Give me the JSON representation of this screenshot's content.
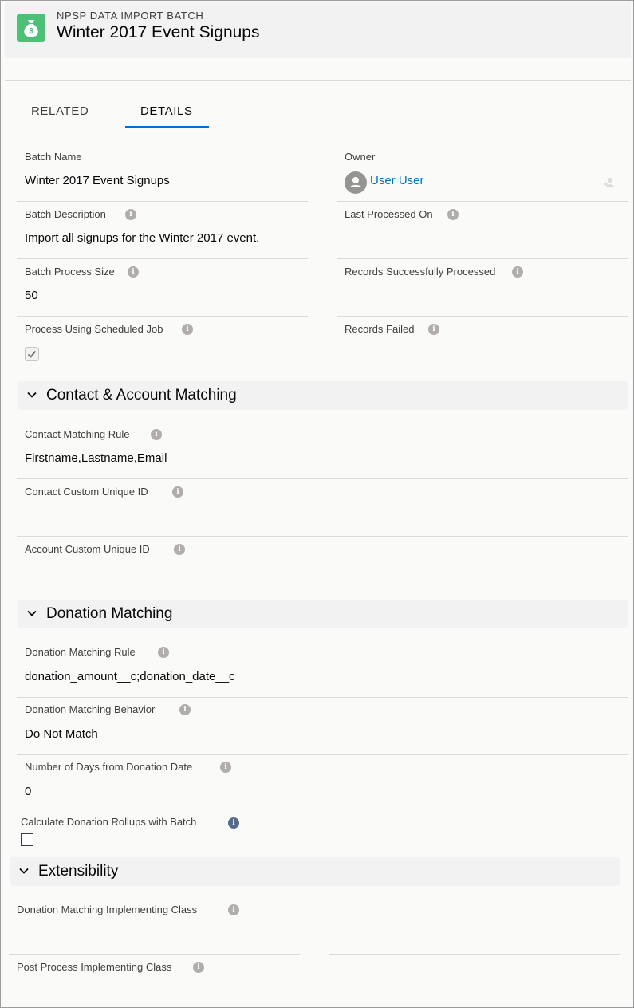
{
  "header": {
    "object_label": "NPSP DATA IMPORT BATCH",
    "title": "Winter 2017 Event Signups",
    "icon": "money-bag-icon",
    "accent_color": "#4bc076"
  },
  "tabs": [
    {
      "label": "RELATED",
      "active": false
    },
    {
      "label": "DETAILS",
      "active": true
    }
  ],
  "details": {
    "batch_name": {
      "label": "Batch Name",
      "value": "Winter 2017 Event Signups"
    },
    "owner": {
      "label": "Owner",
      "value": "User User"
    },
    "batch_description": {
      "label": "Batch Description",
      "value": "Import all signups for the Winter 2017 event."
    },
    "last_processed_on": {
      "label": "Last Processed On",
      "value": ""
    },
    "batch_process_size": {
      "label": "Batch Process Size",
      "value": "50"
    },
    "records_successfully_processed": {
      "label": "Records Successfully Processed",
      "value": ""
    },
    "process_using_scheduled_job": {
      "label": "Process Using Scheduled Job",
      "checked": true
    },
    "records_failed": {
      "label": "Records Failed",
      "value": ""
    }
  },
  "contact_account_section": {
    "title": "Contact & Account Matching",
    "contact_matching_rule": {
      "label": "Contact Matching Rule",
      "value": "Firstname,Lastname,Email"
    },
    "contact_custom_unique_id": {
      "label": "Contact Custom Unique ID",
      "value": ""
    },
    "account_custom_unique_id": {
      "label": "Account Custom Unique ID",
      "value": ""
    }
  },
  "donation_section": {
    "title": "Donation Matching",
    "donation_matching_rule": {
      "label": "Donation Matching Rule",
      "value": "donation_amount__c;donation_date__c"
    },
    "donation_matching_behavior": {
      "label": "Donation Matching Behavior",
      "value": "Do Not Match"
    },
    "days_from_donation_date": {
      "label": "Number of Days from Donation Date",
      "value": "0"
    },
    "calculate_rollups": {
      "label": "Calculate Donation Rollups with Batch",
      "checked": false
    }
  },
  "extensibility_section": {
    "title": "Extensibility",
    "donation_matching_class": {
      "label": "Donation Matching Implementing Class",
      "value": ""
    },
    "post_process_class": {
      "label": "Post Process Implementing Class",
      "value": ""
    }
  }
}
